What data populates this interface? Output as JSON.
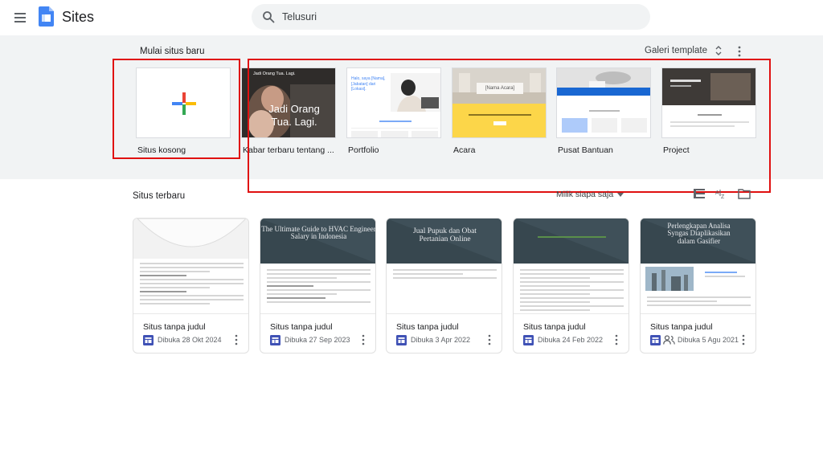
{
  "header": {
    "app_title": "Sites",
    "search_placeholder": "Telusuri"
  },
  "templates_section": {
    "title": "Mulai situs baru",
    "gallery_label": "Galeri template",
    "items": [
      {
        "label": "Situs kosong"
      },
      {
        "label": "Kabar terbaru tentang ...",
        "thumb_title": "Jadi Orang Tua. Lagi.",
        "thumb_headline": "Jadi Orang Tua. Lagi."
      },
      {
        "label": "Portfolio",
        "thumb_text": "Halo, saya [Nama], [Jabatan] dari [Lokasi]."
      },
      {
        "label": "Acara",
        "thumb_text": "[Nama Acara]"
      },
      {
        "label": "Pusat Bantuan"
      },
      {
        "label": "Project"
      }
    ]
  },
  "recent_section": {
    "title": "Situs terbaru",
    "owner_filter": "Milik siapa saja",
    "sites": [
      {
        "title": "Situs tanpa judul",
        "date": "Dibuka 28 Okt 2024",
        "hero": "",
        "shared": false
      },
      {
        "title": "Situs tanpa judul",
        "date": "Dibuka 27 Sep 2023",
        "hero": "The Ultimate Guide to HVAC Engineer Salary in Indonesia",
        "shared": false
      },
      {
        "title": "Situs tanpa judul",
        "date": "Dibuka 3 Apr 2022",
        "hero": "Jual Pupuk dan Obat Pertanian Online",
        "shared": false
      },
      {
        "title": "Situs tanpa judul",
        "date": "Dibuka 24 Feb 2022",
        "hero": "",
        "shared": false
      },
      {
        "title": "Situs tanpa judul",
        "date": "Dibuka 5 Agu 2021",
        "hero": "Perlengkapan Analisa Syngas Diaplikasikan dalam Gasifier",
        "shared": true
      }
    ]
  },
  "colors": {
    "accent_blue": "#4285f4",
    "sites_purple": "#3f51b5",
    "annotation_red": "#e01010",
    "band_grey": "#f1f3f4"
  }
}
